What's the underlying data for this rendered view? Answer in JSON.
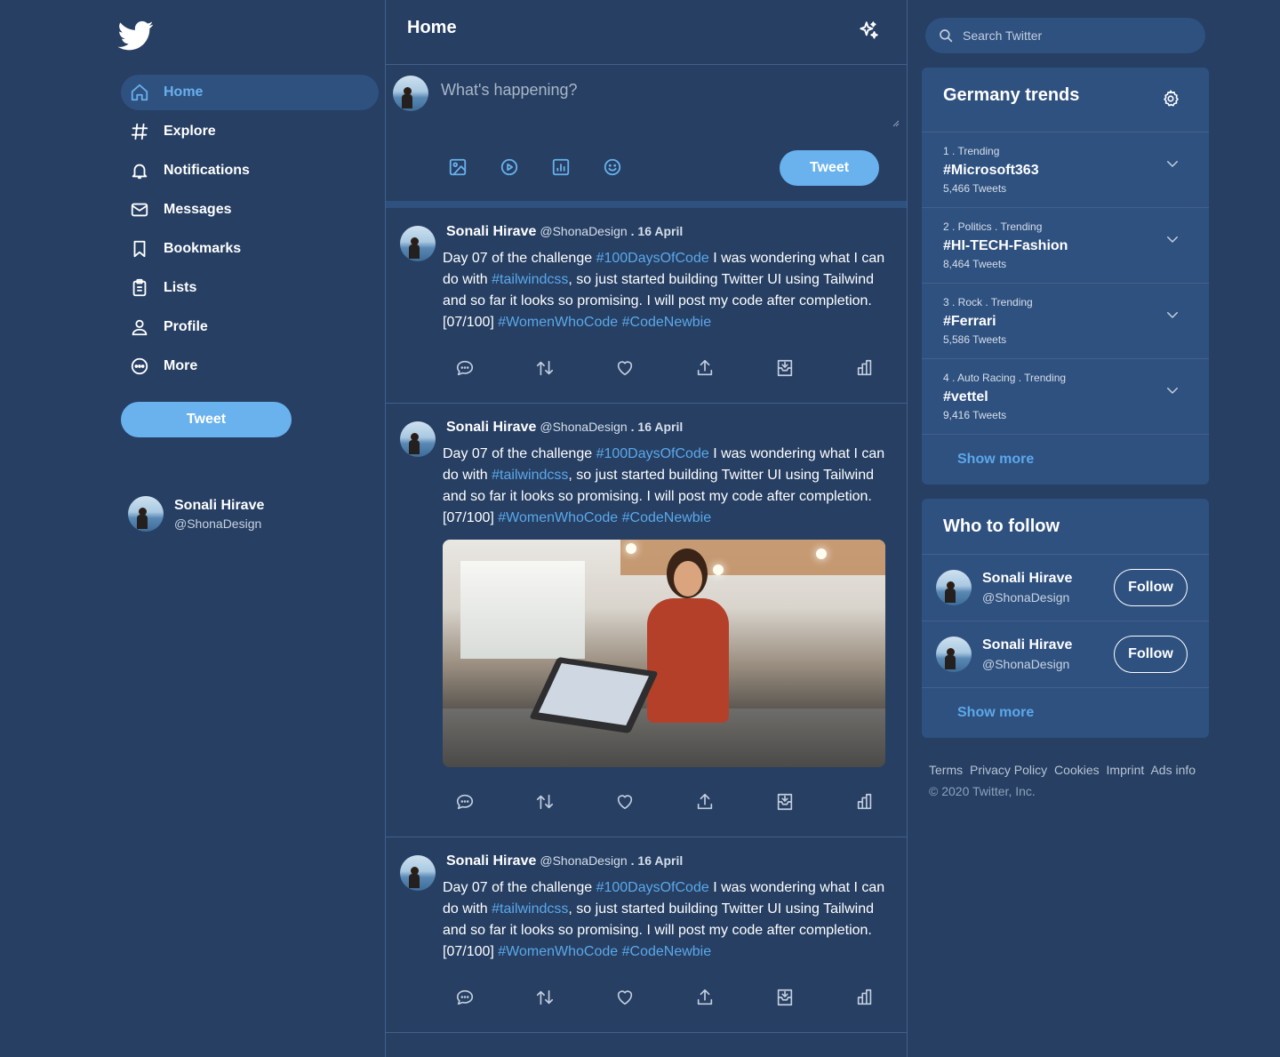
{
  "colors": {
    "background": "#263f63",
    "panel": "#2f5180",
    "accent": "#69b2ee",
    "link": "#5ba8ea"
  },
  "nav": {
    "items": [
      {
        "label": "Home",
        "icon": "home-icon",
        "active": true
      },
      {
        "label": "Explore",
        "icon": "hash-icon"
      },
      {
        "label": "Notifications",
        "icon": "bell-icon"
      },
      {
        "label": "Messages",
        "icon": "envelope-icon"
      },
      {
        "label": "Bookmarks",
        "icon": "bookmark-icon"
      },
      {
        "label": "Lists",
        "icon": "clipboard-list-icon"
      },
      {
        "label": "Profile",
        "icon": "user-icon"
      },
      {
        "label": "More",
        "icon": "more-circle-icon"
      }
    ],
    "tweet_button": "Tweet"
  },
  "current_user": {
    "name": "Sonali Hirave",
    "handle": "@ShonaDesign"
  },
  "feed": {
    "title": "Home",
    "composer": {
      "placeholder": "What's happening?",
      "tweet_button": "Tweet"
    },
    "tweets": [
      {
        "name": "Sonali Hirave",
        "handle": "@ShonaDesign",
        "date": ". 16 April",
        "t1": "Day 07 of the challenge ",
        "tag1": "#100DaysOfCode",
        "t2": " I was wondering what I can do with ",
        "tag2": "#tailwindcss",
        "t3": ", so just started building Twitter UI using Tailwind and so far it looks so promising. I will post my code after completion. [07/100] ",
        "tag3": "#WomenWhoCode",
        "tag4": "#CodeNewbie"
      },
      {
        "name": "Sonali Hirave",
        "handle": "@ShonaDesign",
        "date": ". 16 April",
        "t1": "Day 07 of the challenge ",
        "tag1": "#100DaysOfCode",
        "t2": " I was wondering what I can do with ",
        "tag2": "#tailwindcss",
        "t3": ", so just started building Twitter UI using Tailwind and so far it looks so promising. I will post my code after completion. [07/100] ",
        "tag3": "#WomenWhoCode",
        "tag4": "#CodeNewbie"
      },
      {
        "name": "Sonali Hirave",
        "handle": "@ShonaDesign",
        "date": ". 16 April",
        "t1": "Day 07 of the challenge ",
        "tag1": "#100DaysOfCode",
        "t2": " I was wondering what I can do with ",
        "tag2": "#tailwindcss",
        "t3": ", so just started building Twitter UI using Tailwind and so far it looks so promising. I will post my code after completion. [07/100] ",
        "tag3": "#WomenWhoCode",
        "tag4": "#CodeNewbie"
      }
    ]
  },
  "search": {
    "placeholder": "Search Twitter"
  },
  "trends": {
    "title": "Germany trends",
    "items": [
      {
        "meta": "1 . Trending",
        "tag": "#Microsoft363",
        "count": "5,466 Tweets"
      },
      {
        "meta": "2 . Politics . Trending",
        "tag": "#HI-TECH-Fashion",
        "count": "8,464 Tweets"
      },
      {
        "meta": "3 . Rock . Trending",
        "tag": "#Ferrari",
        "count": "5,586 Tweets"
      },
      {
        "meta": "4 . Auto Racing . Trending",
        "tag": "#vettel",
        "count": "9,416 Tweets"
      }
    ],
    "show_more": "Show more"
  },
  "who_to_follow": {
    "title": "Who to follow",
    "items": [
      {
        "name": "Sonali Hirave",
        "handle": "@ShonaDesign",
        "button": "Follow"
      },
      {
        "name": "Sonali Hirave",
        "handle": "@ShonaDesign",
        "button": "Follow"
      }
    ],
    "show_more": "Show more"
  },
  "footer": {
    "links": [
      "Terms",
      "Privacy Policy",
      "Cookies",
      "Imprint",
      "Ads info"
    ],
    "copyright": "© 2020 Twitter, Inc."
  }
}
